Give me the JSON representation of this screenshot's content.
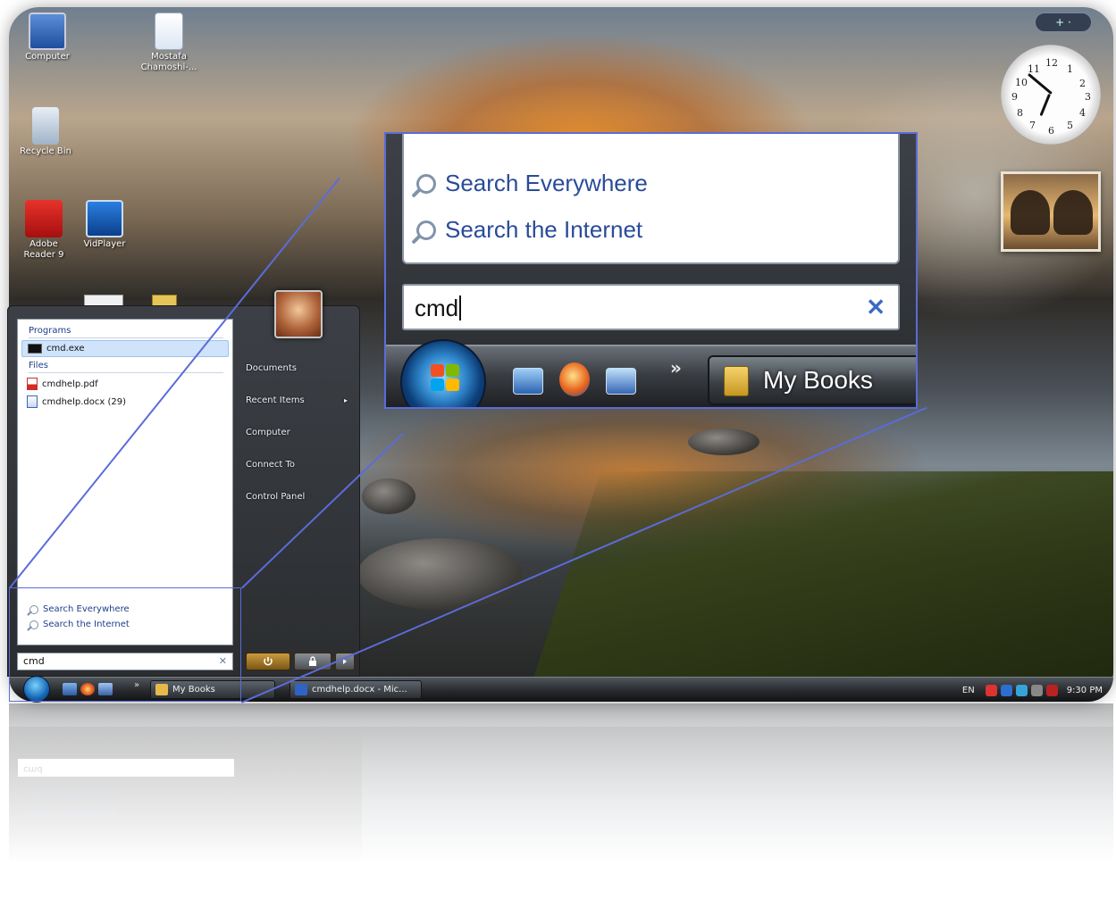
{
  "desktop": {
    "icons": [
      {
        "label": "Computer",
        "icon": "computer-icon"
      },
      {
        "label": "Mostafa Chamoshi-...",
        "icon": "document-icon"
      },
      {
        "label": "Recycle Bin",
        "icon": "recycle-bin-icon"
      },
      {
        "label": "Adobe Reader 9",
        "icon": "adobe-reader-icon"
      },
      {
        "label": "VidPlayer",
        "icon": "video-player-icon"
      }
    ]
  },
  "gadgets": {
    "toggle_label": "+ ·",
    "clock_numbers": [
      "12",
      "1",
      "2",
      "3",
      "4",
      "5",
      "6",
      "7",
      "8",
      "9",
      "10",
      "11"
    ]
  },
  "start_menu": {
    "programs_heading": "Programs",
    "programs": [
      {
        "label": "cmd.exe",
        "icon": "cmd-icon"
      }
    ],
    "files_heading": "Files",
    "files": [
      {
        "label": "cmdhelp.pdf",
        "icon": "pdf-icon"
      },
      {
        "label": "cmdhelp.docx (29)",
        "icon": "word-document-icon"
      }
    ],
    "search_everywhere": "Search Everywhere",
    "search_internet": "Search the Internet",
    "search_value": "cmd",
    "right_items": [
      {
        "label": "Documents"
      },
      {
        "label": "Recent Items",
        "submenu": "▸"
      },
      {
        "label": "Computer"
      },
      {
        "label": "Connect To"
      },
      {
        "label": "Control Panel"
      }
    ]
  },
  "taskbar": {
    "tasks": [
      {
        "label": "My Books",
        "icon": "folder-icon",
        "color": "#e6b94a"
      },
      {
        "label": "cmdhelp.docx - Mic...",
        "icon": "word-icon",
        "color": "#2f63c6"
      }
    ],
    "language": "EN",
    "time": "9:30 PM"
  },
  "zoom": {
    "search_everywhere": "Search Everywhere",
    "search_internet": "Search the Internet",
    "search_value": "cmd",
    "clear_glyph": "✕",
    "chevron": "»",
    "task_label": "My Books"
  },
  "colors": {
    "callout_border": "#5a6cd8",
    "link_blue": "#2a4b9a",
    "windows_blue": "#2d83c8"
  }
}
